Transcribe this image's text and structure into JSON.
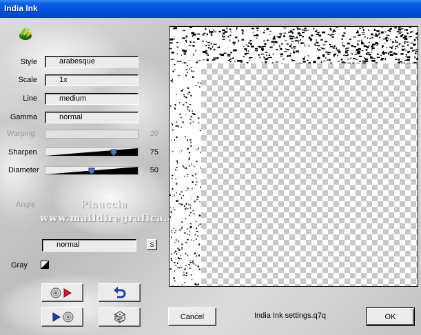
{
  "window": {
    "title": "India Ink"
  },
  "controls": {
    "style": {
      "label": "Style",
      "value": "arabesque"
    },
    "scale": {
      "label": "Scale",
      "value": "1x"
    },
    "line": {
      "label": "Line",
      "value": "medium"
    },
    "gamma": {
      "label": "Gamma",
      "value": "normal"
    },
    "warping": {
      "label": "Warping",
      "value": "20",
      "level": 0.2,
      "disabled": true
    },
    "sharpen": {
      "label": "Sharpen",
      "value": "75",
      "level": 0.75
    },
    "diameter": {
      "label": "Diameter",
      "value": "50",
      "level": 0.5
    },
    "angle": {
      "label": "Angle",
      "disabled": true
    }
  },
  "preset": {
    "value": "normal",
    "save_label": "S"
  },
  "gray": {
    "label": "Gray"
  },
  "watermark": {
    "line1": "Pinuccia",
    "line2": "www.maildiregrafica.eu"
  },
  "buttons": {
    "cancel": "Cancel",
    "ok": "OK"
  },
  "status": {
    "filename": "India Ink settings.q7q"
  },
  "icons": {
    "logo": "leaf-logo-icon",
    "load_preset": "disc-to-play-icon",
    "save_preset": "play-to-disc-icon",
    "undo": "undo-arrow-icon",
    "random": "dice-icon"
  },
  "colors": {
    "title_bar": "#0054e3",
    "preview_ink": "#000000",
    "checker": "#c8c8c8"
  }
}
